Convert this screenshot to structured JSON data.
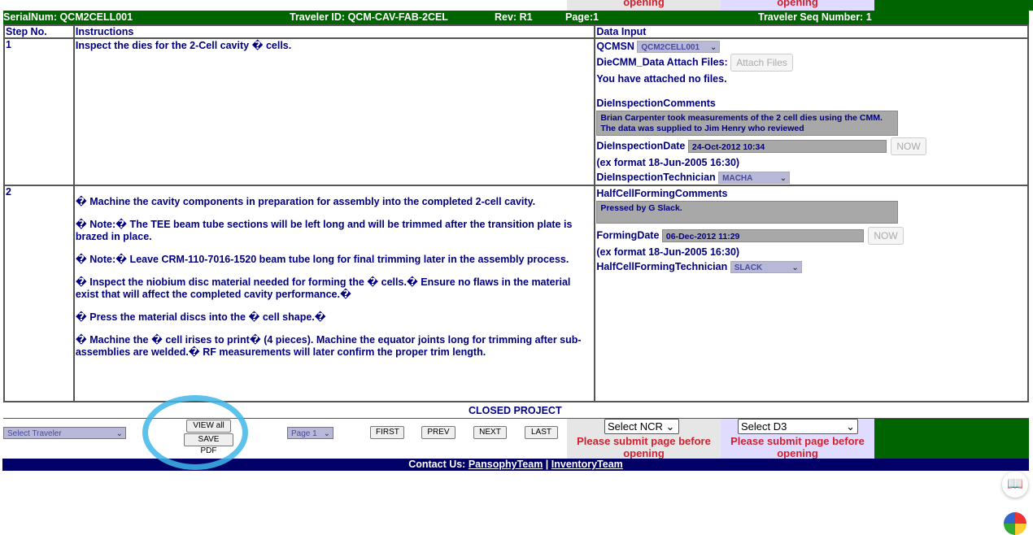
{
  "top_strip": {
    "ncr_msg": "opening",
    "d3_msg": "opening"
  },
  "header": {
    "serial": "SerialNum: QCM2CELL001",
    "traveler_id": "Traveler ID: QCM-CAV-FAB-2CEL",
    "rev": "Rev: R1",
    "page": "Page:1",
    "seq": "Traveler Seq Number: 1"
  },
  "table": {
    "headers": [
      "Step No.",
      "Instructions",
      "Data Input"
    ],
    "step1": {
      "num": "1",
      "instruction": "Inspect the dies for the 2-Cell cavity � cells.",
      "qcmsn_label": "QCMSN",
      "qcmsn_value": "QCM2CELL001",
      "attach_label": "DieCMM_Data Attach Files:",
      "attach_button": "Attach Files",
      "attached_note": "You have attached no files.",
      "comments_label": "DieInspectionComments",
      "comments_value": "Brian Carpenter took measurements of the 2 cell dies using the CMM.  The data was supplied to Jim Henry who reviewed",
      "date_label": "DieInspectionDate",
      "date_value": "24-Oct-2012 10:34",
      "now_button": "NOW",
      "format_hint": "(ex format 18-Jun-2005 16:30)",
      "tech_label": "DieInspectionTechnician",
      "tech_value": "MACHA"
    },
    "step2": {
      "num": "2",
      "paragraphs": [
        "�     Machine the cavity components in preparation for assembly into the completed 2-cell cavity.",
        "�     Note:� The TEE beam tube sections will be left long and will be trimmed after the transition plate is brazed in place.",
        "�     Note:� Leave CRM-110-7016-1520 beam tube long for final trimming later in the assembly process.",
        "�     Inspect the niobium disc material needed for forming the � cells.� Ensure no flaws in the material exist that will affect the completed cavity performance.�",
        "�     Press the material discs into the � cell shape.�",
        "�     Machine the � cell irises to print� (4 pieces). Machine the equator joints long for trimming after sub-assemblies are welded.� RF measurements will later confirm the proper trim length."
      ],
      "comments_label": "HalfCellFormingComments",
      "comments_value": "Pressed by G Slack.",
      "date_label": "FormingDate",
      "date_value": "06-Dec-2012 11:29",
      "now_button": "NOW",
      "format_hint": "(ex format 18-Jun-2005 16:30)",
      "tech_label": "HalfCellFormingTechnician",
      "tech_value": "SLACK"
    }
  },
  "closed_label": "CLOSED PROJECT",
  "bottom": {
    "select_traveler": "Select Traveler",
    "view_all": "VIEW all",
    "save_pdf": "SAVE PDF",
    "page_select": "Page 1",
    "first": "FIRST",
    "prev": "PREV",
    "next": "NEXT",
    "last": "LAST",
    "ncr_select": "Select NCR",
    "ncr_msg": "Please submit page before opening",
    "d3_select": "Select D3",
    "d3_msg": "Please submit page before opening"
  },
  "footer": {
    "prefix": "Contact Us:",
    "link1": "PansophyTeam",
    "sep": "|",
    "link2": "InventoryTeam"
  },
  "colors": {
    "header_green": "#006400",
    "footer_navy": "#000066",
    "text_navy": "#000080",
    "warning_red": "#d0202e",
    "annotation_blue": "#3fb6e8"
  },
  "icons": [
    "chevron-down-icon",
    "reader-icon",
    "chrome-icon"
  ]
}
